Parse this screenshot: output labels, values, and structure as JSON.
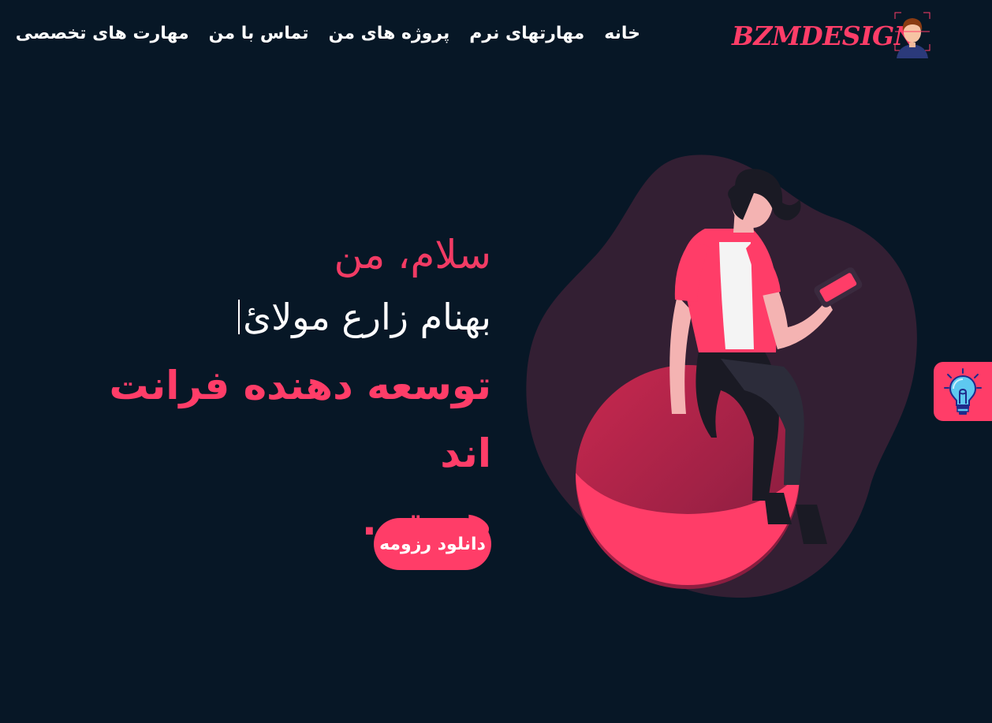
{
  "header": {
    "brand": "BZMDESIGN",
    "nav": [
      {
        "label": "خانه"
      },
      {
        "label": "مهارتهای نرم"
      },
      {
        "label": "پروژه های من"
      },
      {
        "label": "تماس با من"
      },
      {
        "label": "مهارت های تخصصی"
      }
    ]
  },
  "hero": {
    "greeting": "سلام، من",
    "name": "بهنام زارع مولائ",
    "role_line1": "توسعه دهنده فرانت اند",
    "role_line2": "هستم.",
    "cta_label": "دانلود رزومه"
  },
  "colors": {
    "background": "#071726",
    "accent": "#ff3d68",
    "blob": "#331f33"
  },
  "icons": {
    "avatar": "developer-avatar-icon",
    "theme_toggle": "lightbulb-icon"
  }
}
